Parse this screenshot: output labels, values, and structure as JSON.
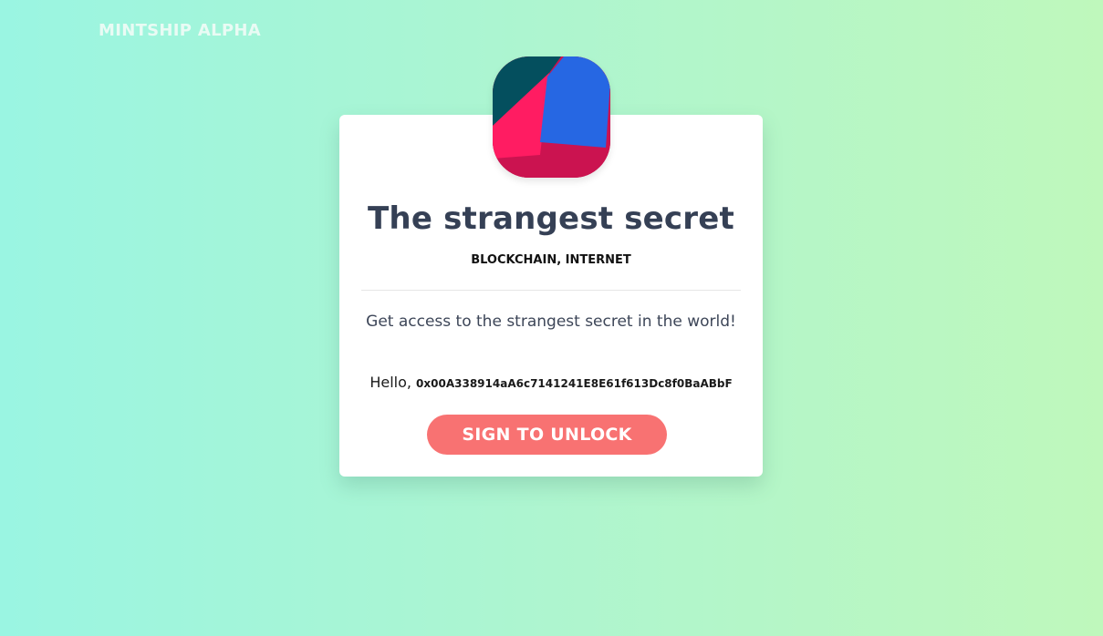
{
  "app": {
    "brand": "MINTSHIP ALPHA"
  },
  "logo": {
    "icon": "colorful-shapes-logo-icon",
    "colors": {
      "teal": "#044f5e",
      "blue": "#2667e3",
      "pink": "#ff1c62",
      "crimson": "#cb1350"
    }
  },
  "secret": {
    "title": "The strangest secret",
    "tags": "BLOCKCHAIN, INTERNET",
    "description": "Get access to the strangest secret in the world!"
  },
  "user": {
    "greeting": "Hello, ",
    "address": "0x00A338914aA6c7141241E8E61f613Dc8f0BaABbF"
  },
  "actions": {
    "unlock_label": "SIGN TO UNLOCK"
  },
  "colors": {
    "accent": "#f87272",
    "title_text": "#354055"
  }
}
